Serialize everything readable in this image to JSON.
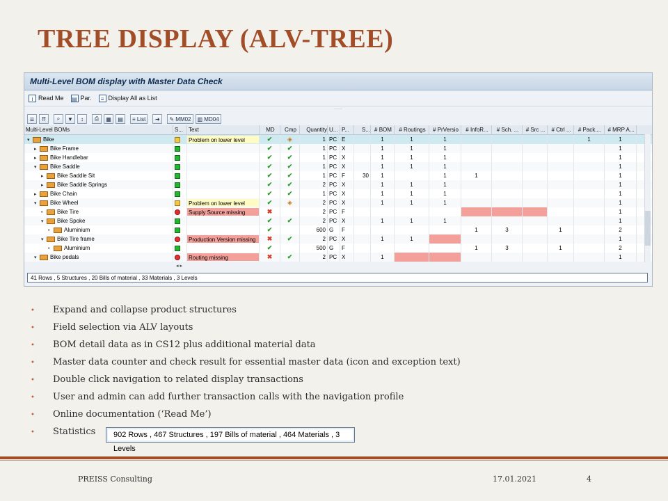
{
  "slide": {
    "title": "TREE DISPLAY (ALV-TREE)",
    "footer_left": "PREISS  Consulting",
    "footer_date": "17.01.2021",
    "page_number": "4"
  },
  "sap": {
    "window_title": "Multi-Level BOM display with Master Data Check",
    "app_toolbar": [
      {
        "label": "Read Me",
        "icon": "info-icon"
      },
      {
        "label": "Par.",
        "icon": "parameter-icon"
      },
      {
        "label": "Display All as List",
        "icon": "list-icon"
      }
    ],
    "alv_toolbar": {
      "list_label": "List",
      "mm02_label": "MM02",
      "md04_label": "MD04"
    },
    "columns": [
      "Multi-Level BOMs",
      "S...",
      "Text",
      "MD",
      "Cmp",
      "Quantity",
      "U...",
      "P...",
      "S...",
      "# BOM",
      "# Routings",
      "# PrVersio",
      "# InfoR...",
      "# Sch. ...",
      "# Src ...",
      "# Ctrl ...",
      "# Pack....",
      "# MRP A..."
    ],
    "rows": [
      {
        "indent": 0,
        "caret": "▾",
        "name": "Bike",
        "status": "warn",
        "text": "Problem on lower level",
        "textstyle": "y",
        "md": "✔",
        "cmp": "warn",
        "qty": "1",
        "unit": "PC",
        "p": "E",
        "s": "",
        "bom": "1",
        "rt": "1",
        "pv": "1",
        "inf": "",
        "sch": "",
        "src": "",
        "ctrl": "",
        "pack": "1",
        "mrp": "1",
        "hl": [],
        "style": "sel"
      },
      {
        "indent": 1,
        "caret": "▸",
        "name": "Bike Frame",
        "status": "green",
        "text": "",
        "textstyle": "",
        "md": "✔",
        "cmp": "✔",
        "qty": "1",
        "unit": "PC",
        "p": "X",
        "s": "",
        "bom": "1",
        "rt": "1",
        "pv": "1",
        "inf": "",
        "sch": "",
        "src": "",
        "ctrl": "",
        "pack": "",
        "mrp": "1",
        "hl": [],
        "style": "alt"
      },
      {
        "indent": 1,
        "caret": "▸",
        "name": "Bike Handlebar",
        "status": "green",
        "text": "",
        "textstyle": "",
        "md": "✔",
        "cmp": "✔",
        "qty": "1",
        "unit": "PC",
        "p": "X",
        "s": "",
        "bom": "1",
        "rt": "1",
        "pv": "1",
        "inf": "",
        "sch": "",
        "src": "",
        "ctrl": "",
        "pack": "",
        "mrp": "1",
        "hl": [],
        "style": "plain"
      },
      {
        "indent": 1,
        "caret": "▾",
        "name": "Bike Saddle",
        "status": "green",
        "text": "",
        "textstyle": "",
        "md": "✔",
        "cmp": "✔",
        "qty": "1",
        "unit": "PC",
        "p": "X",
        "s": "",
        "bom": "1",
        "rt": "1",
        "pv": "1",
        "inf": "",
        "sch": "",
        "src": "",
        "ctrl": "",
        "pack": "",
        "mrp": "1",
        "hl": [],
        "style": "alt"
      },
      {
        "indent": 2,
        "caret": "▸",
        "name": "Bike Saddle Sit",
        "status": "green",
        "text": "",
        "textstyle": "",
        "md": "✔",
        "cmp": "✔",
        "qty": "1",
        "unit": "PC",
        "p": "F",
        "s": "30",
        "bom": "1",
        "rt": "",
        "pv": "1",
        "inf": "1",
        "sch": "",
        "src": "",
        "ctrl": "",
        "pack": "",
        "mrp": "1",
        "hl": [],
        "style": "plain"
      },
      {
        "indent": 2,
        "caret": "▸",
        "name": "Bike Saddle Springs",
        "status": "green",
        "text": "",
        "textstyle": "",
        "md": "✔",
        "cmp": "✔",
        "qty": "2",
        "unit": "PC",
        "p": "X",
        "s": "",
        "bom": "1",
        "rt": "1",
        "pv": "1",
        "inf": "",
        "sch": "",
        "src": "",
        "ctrl": "",
        "pack": "",
        "mrp": "1",
        "hl": [],
        "style": "alt"
      },
      {
        "indent": 1,
        "caret": "▸",
        "name": "Bike Chain",
        "status": "green",
        "text": "",
        "textstyle": "",
        "md": "✔",
        "cmp": "✔",
        "qty": "1",
        "unit": "PC",
        "p": "X",
        "s": "",
        "bom": "1",
        "rt": "1",
        "pv": "1",
        "inf": "",
        "sch": "",
        "src": "",
        "ctrl": "",
        "pack": "",
        "mrp": "1",
        "hl": [],
        "style": "plain"
      },
      {
        "indent": 1,
        "caret": "▾",
        "name": "Bike Wheel",
        "status": "warn",
        "text": "Problem on lower level",
        "textstyle": "y",
        "md": "✔",
        "cmp": "warn",
        "qty": "2",
        "unit": "PC",
        "p": "X",
        "s": "",
        "bom": "1",
        "rt": "1",
        "pv": "1",
        "inf": "",
        "sch": "",
        "src": "",
        "ctrl": "",
        "pack": "",
        "mrp": "1",
        "hl": [],
        "style": "alt"
      },
      {
        "indent": 2,
        "caret": "•",
        "name": "Bike Tire",
        "status": "red",
        "text": "Supply Source missing",
        "textstyle": "r",
        "md": "✖",
        "cmp": "",
        "qty": "2",
        "unit": "PC",
        "p": "F",
        "s": "",
        "bom": "",
        "rt": "",
        "pv": "",
        "inf": "",
        "sch": "",
        "src": "",
        "ctrl": "",
        "pack": "",
        "mrp": "1",
        "hl": [
          "inf",
          "sch",
          "src"
        ],
        "style": "plain"
      },
      {
        "indent": 2,
        "caret": "▾",
        "name": "Bike Spoke",
        "status": "green",
        "text": "",
        "textstyle": "",
        "md": "✔",
        "cmp": "✔",
        "qty": "2",
        "unit": "PC",
        "p": "X",
        "s": "",
        "bom": "1",
        "rt": "1",
        "pv": "1",
        "inf": "",
        "sch": "",
        "src": "",
        "ctrl": "",
        "pack": "",
        "mrp": "1",
        "hl": [],
        "style": "alt"
      },
      {
        "indent": 3,
        "caret": "•",
        "name": "Aluminium",
        "status": "green",
        "text": "",
        "textstyle": "",
        "md": "✔",
        "cmp": "",
        "qty": "600",
        "unit": "G",
        "p": "F",
        "s": "",
        "bom": "",
        "rt": "",
        "pv": "",
        "inf": "1",
        "sch": "3",
        "src": "",
        "ctrl": "1",
        "pack": "",
        "mrp": "2",
        "hl": [],
        "style": "plain"
      },
      {
        "indent": 2,
        "caret": "▾",
        "name": "Bike Tire frame",
        "status": "red",
        "text": "Production Version missing",
        "textstyle": "r",
        "md": "✖",
        "cmp": "✔",
        "qty": "2",
        "unit": "PC",
        "p": "X",
        "s": "",
        "bom": "1",
        "rt": "1",
        "pv": "",
        "inf": "",
        "sch": "",
        "src": "",
        "ctrl": "",
        "pack": "",
        "mrp": "1",
        "hl": [
          "pv"
        ],
        "style": "alt"
      },
      {
        "indent": 3,
        "caret": "•",
        "name": "Aluminium",
        "status": "green",
        "text": "",
        "textstyle": "",
        "md": "✔",
        "cmp": "",
        "qty": "500",
        "unit": "G",
        "p": "F",
        "s": "",
        "bom": "",
        "rt": "",
        "pv": "",
        "inf": "1",
        "sch": "3",
        "src": "",
        "ctrl": "1",
        "pack": "",
        "mrp": "2",
        "hl": [],
        "style": "plain"
      },
      {
        "indent": 1,
        "caret": "▾",
        "name": "Bike pedals",
        "status": "red",
        "text": "Routing missing",
        "textstyle": "r",
        "md": "✖",
        "cmp": "✔",
        "qty": "2",
        "unit": "PC",
        "p": "X",
        "s": "",
        "bom": "1",
        "rt": "",
        "pv": "",
        "inf": "",
        "sch": "",
        "src": "",
        "ctrl": "",
        "pack": "",
        "mrp": "1",
        "hl": [
          "rt",
          "pv"
        ],
        "style": "alt"
      }
    ],
    "status_text": "41 Rows , 5 Structures , 20 Bills of material , 33 Materials , 3 Levels"
  },
  "bullets": [
    "Expand and collapse product structures",
    "Field selection via ALV layouts",
    "BOM detail data as in CS12 plus additional material data",
    "Master data counter and check result for essential master data (icon and exception text)",
    "Double click navigation to related display transactions",
    "User and admin can add further transaction calls with the navigation profile",
    "Online documentation (‘Read Me’)",
    "Statistics"
  ],
  "statistics_box": "902 Rows , 467 Structures , 197 Bills of material , 464 Materials , 3 Levels",
  "colors": {
    "accent": "#a04d28",
    "error_bg": "#f4a09a",
    "warning_bg": "#fffbc4",
    "selected_row": "#cfe9f0"
  }
}
